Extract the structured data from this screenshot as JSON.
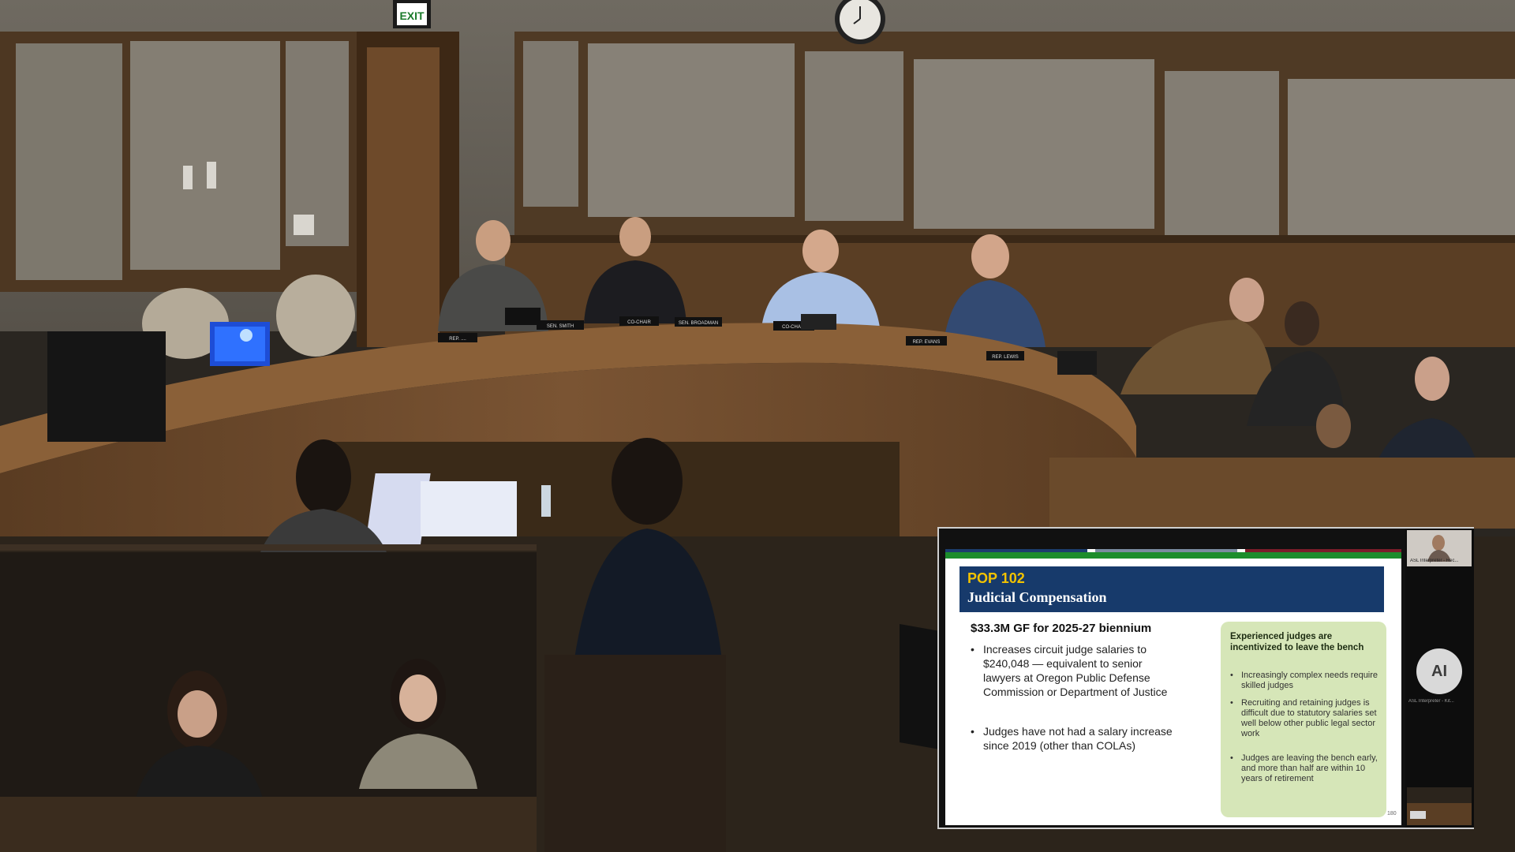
{
  "room": {
    "exit_sign": "EXIT",
    "nameplates": [
      "REP. ....",
      "SEN. SMITH",
      "CO-CHAIR",
      "SEN. BROADMAN",
      "CO-CHAIR",
      "REP. EVANS",
      "REP. LEWIS"
    ]
  },
  "slide": {
    "pop_label": "POP 102",
    "title": "Judicial Compensation",
    "funding": "$33.3M GF for 2025-27 biennium",
    "bullets": [
      "Increases circuit judge salaries to $240,048 — equivalent to senior lawyers at Oregon Public Defense Commission or Department of Justice",
      "Judges have not had a salary increase since 2019 (other than COLAs)"
    ],
    "callout": {
      "title": "Experienced judges are incentivized to leave the bench",
      "items": [
        "Increasingly complex needs require skilled judges",
        "Recruiting and retaining judges is difficult due to statutory salaries set well below other public legal sector work",
        "Judges are leaving the bench early, and more than half are within 10 years of retirement"
      ]
    },
    "page_number": "180"
  },
  "participants": {
    "interpreter_name": "ASL Interpreter - Rec...",
    "ai_initials": "AI",
    "ai_name": "ASL Interpreter - Kit..."
  },
  "colors": {
    "slide_header": "#173a6b",
    "pop_label": "#f2c200",
    "callout_bg": "#d6e6b8",
    "wood": "#6b4a2c",
    "wall": "#8a8478"
  }
}
